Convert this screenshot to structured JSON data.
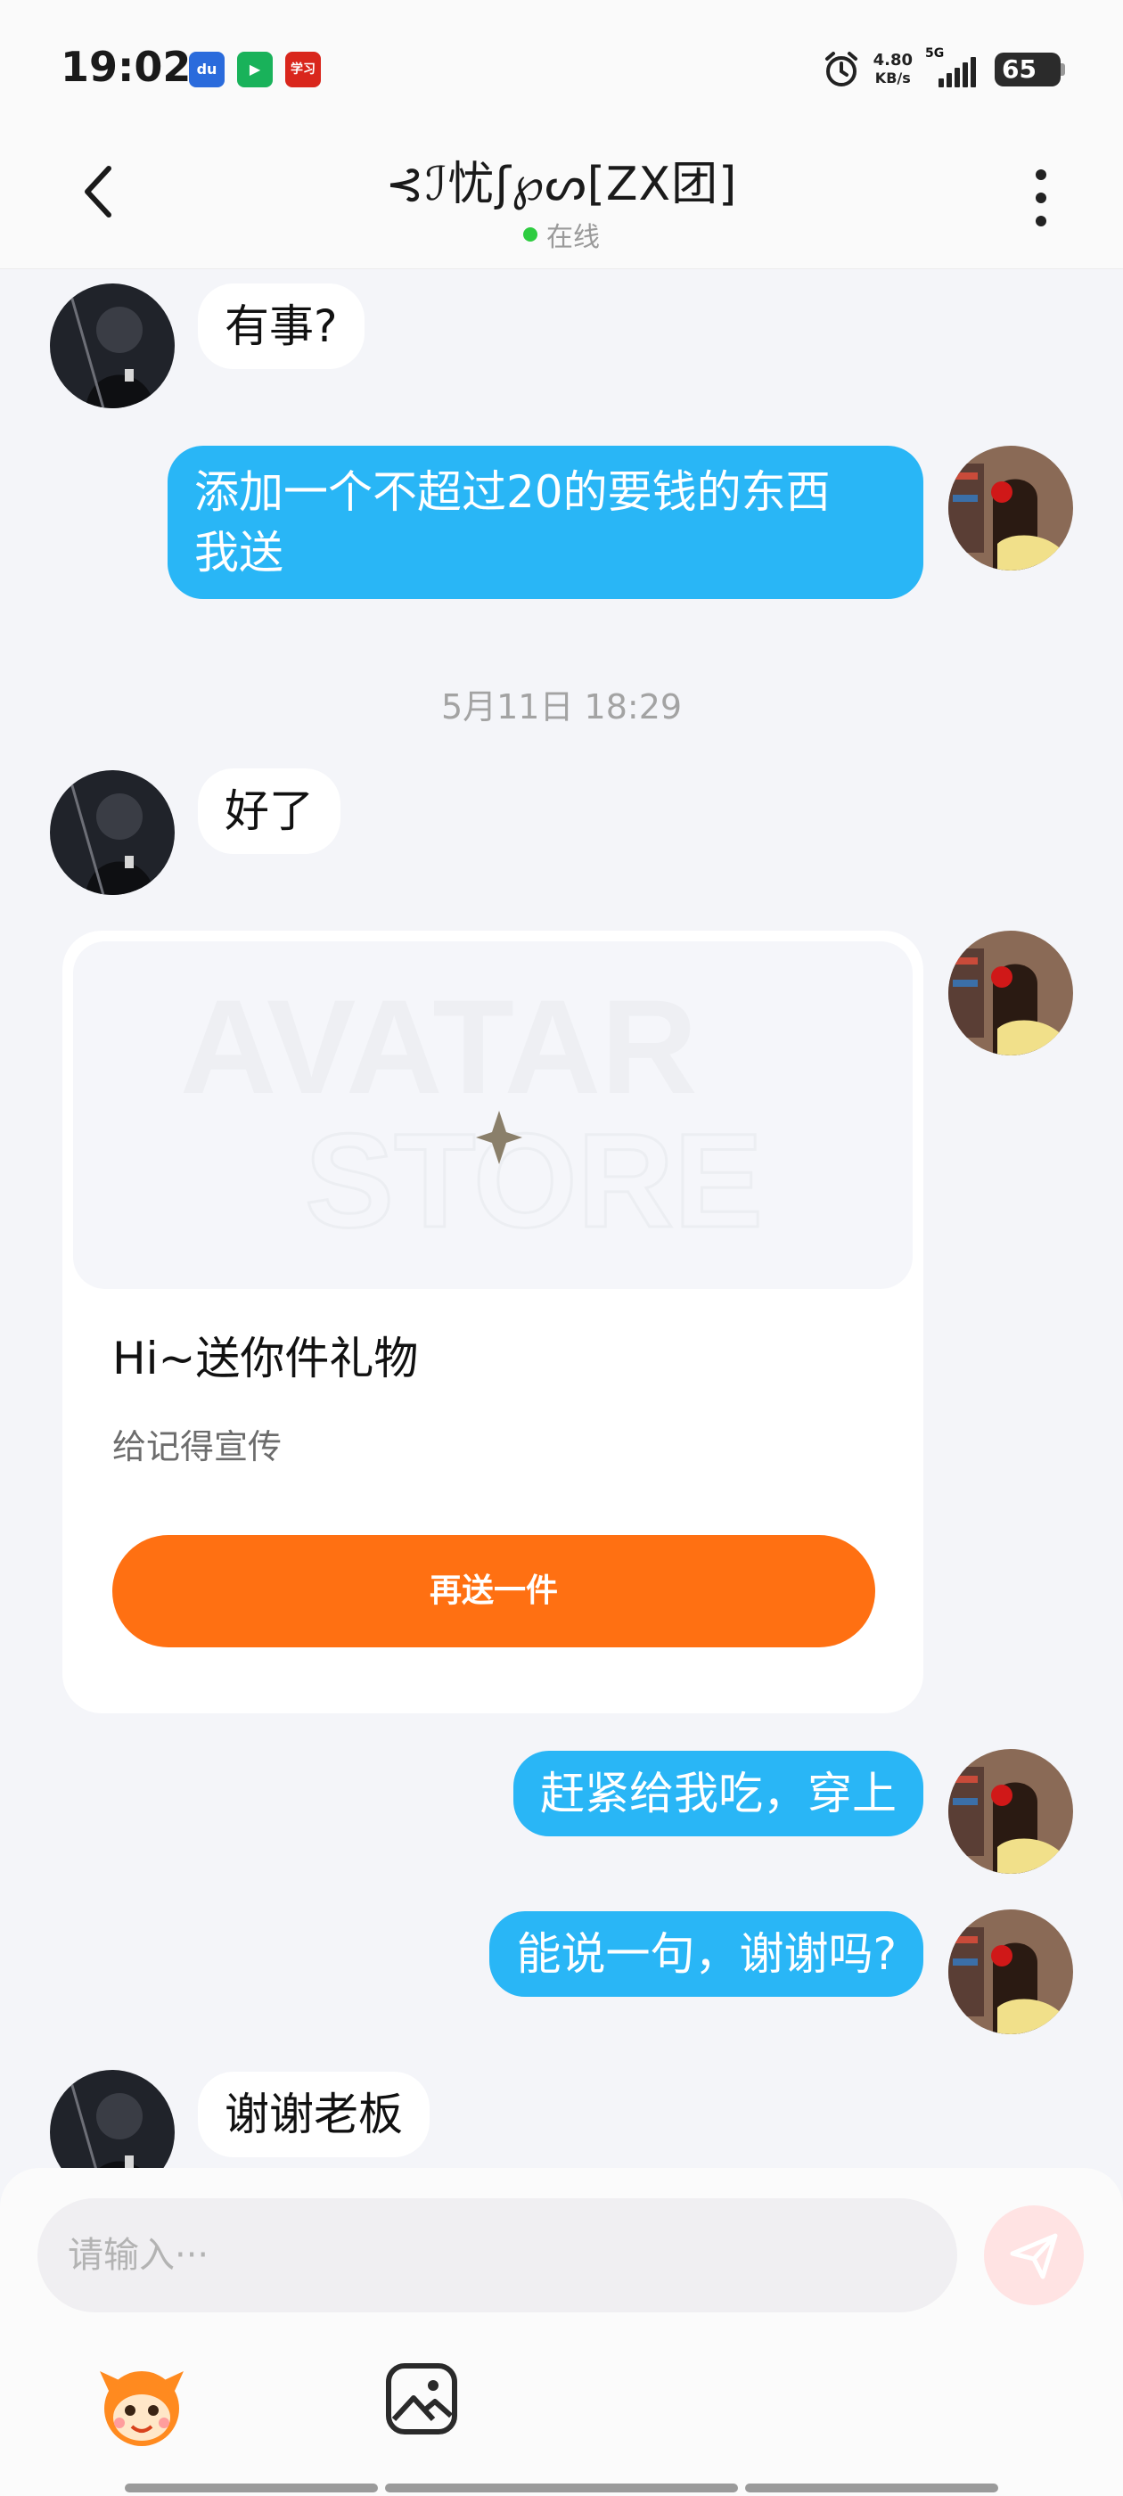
{
  "status_bar": {
    "time": "19:02",
    "net_speed_value": "4.80",
    "net_speed_unit": "KB/s",
    "network": "5G",
    "battery": "65",
    "apps": [
      {
        "label": "du",
        "color": "#2a6bdc"
      },
      {
        "label": "▶",
        "color": "#19b25a"
      },
      {
        "label": "学习",
        "color": "#d9261c"
      }
    ]
  },
  "header": {
    "title": "⊰ℐ忧ʃ℘ᔕ[ZX团]",
    "status": "在线"
  },
  "messages": [
    {
      "side": "in",
      "text": "有事?"
    },
    {
      "side": "out",
      "text": "添加一个不超过20的要钱的东西\n我送"
    },
    {
      "type": "time",
      "text": "5月11日 18:29"
    },
    {
      "side": "in",
      "text": "好了"
    },
    {
      "side": "out",
      "text": "赶紧给我吃，穿上"
    },
    {
      "side": "out",
      "text": "能说一句，谢谢吗?"
    },
    {
      "side": "in",
      "text": "谢谢老板"
    }
  ],
  "gift_card": {
    "banner_text_top": "AVATAR",
    "banner_text_bottom": "STORE",
    "title": "Hi~送你件礼物",
    "subtitle": "给记得宣传",
    "button": "再送一件"
  },
  "input": {
    "placeholder": "请输入···"
  },
  "colors": {
    "out_bubble": "#29b6f6",
    "accent_button": "#ff7012",
    "online": "#2ecc40"
  }
}
